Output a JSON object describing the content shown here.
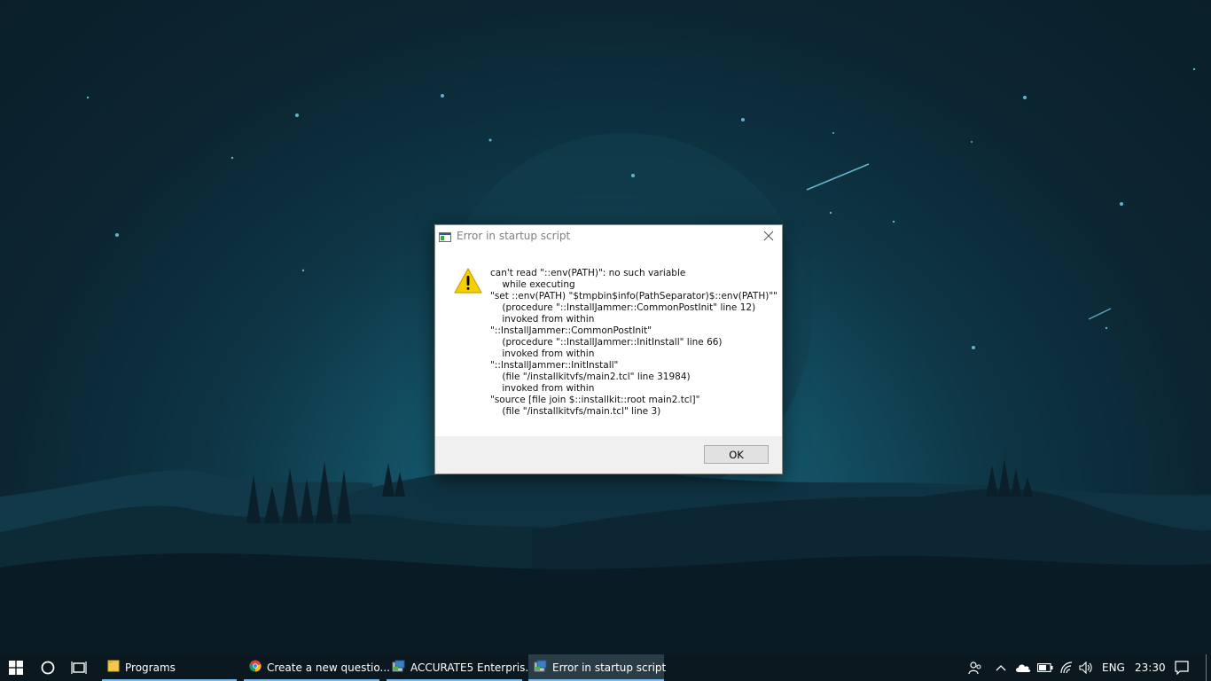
{
  "dialog": {
    "title": "Error in startup script",
    "message": "can't read \"::env(PATH)\": no such variable\n    while executing\n\"set ::env(PATH) \"$tmpbin$info(PathSeparator)$::env(PATH)\"\"\n    (procedure \"::InstallJammer::CommonPostInit\" line 12)\n    invoked from within\n\"::InstallJammer::CommonPostInit\"\n    (procedure \"::InstallJammer::InitInstall\" line 66)\n    invoked from within\n\"::InstallJammer::InitInstall\"\n    (file \"/installkitvfs/main2.tcl\" line 31984)\n    invoked from within\n\"source [file join $::installkit::root main2.tcl]\"\n    (file \"/installkitvfs/main.tcl\" line 3)",
    "ok_label": "OK",
    "icon": "warning-icon",
    "close_icon": "close-icon"
  },
  "taskbar": {
    "start_icon": "windows-logo-icon",
    "search_icon": "cortana-circle-icon",
    "task_view_icon": "task-view-icon",
    "apps": [
      {
        "label": "Programs",
        "icon": "folder-icon"
      },
      {
        "label": "Create a new questio...",
        "icon": "chrome-icon"
      },
      {
        "label": "ACCURATE5 Enterpris...",
        "icon": "installer-icon"
      },
      {
        "label": "Error in startup script",
        "icon": "installer-icon",
        "active": true
      }
    ],
    "tray": {
      "language": "ENG",
      "time": "23:30",
      "icons": [
        "people-icon",
        "chevron-up-icon",
        "onedrive-icon",
        "battery-icon",
        "wifi-icon",
        "volume-icon",
        "action-center-icon"
      ]
    }
  },
  "colors": {
    "taskbar_bg": "#0b1820",
    "active_underline": "#76b9ed",
    "warning_yellow": "#f5d000"
  }
}
